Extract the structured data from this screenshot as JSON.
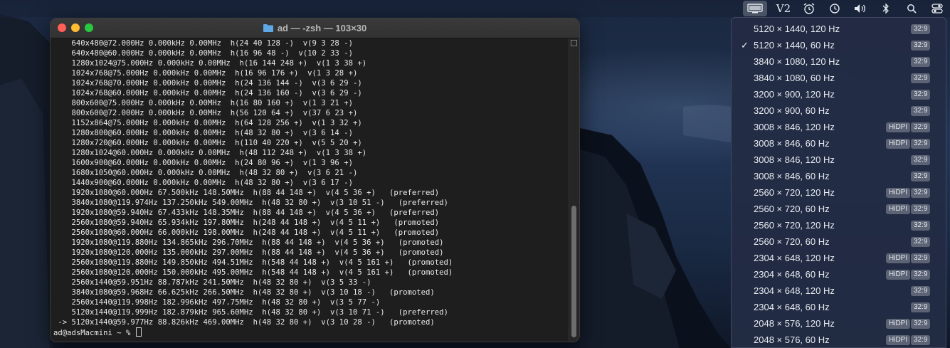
{
  "menubar": {
    "icons": [
      "display-icon",
      "v2-icon",
      "alarm-icon",
      "time-machine-icon",
      "volume-icon",
      "bluetooth-icon",
      "search-icon",
      "control-center-icon"
    ],
    "v2_label": "V2"
  },
  "terminal": {
    "title": "ad — -zsh — 103×30",
    "lines": [
      "    640x480@72.000Hz 0.000kHz 0.00MHz  h(24 40 128 -)  v(9 3 28 -)",
      "    640x480@60.000Hz 0.000kHz 0.00MHz  h(16 96 48 -)  v(10 2 33 -)",
      "    1280x1024@75.000Hz 0.000kHz 0.00MHz  h(16 144 248 +)  v(1 3 38 +)",
      "    1024x768@75.000Hz 0.000kHz 0.00MHz  h(16 96 176 +)  v(1 3 28 +)",
      "    1024x768@70.000Hz 0.000kHz 0.00MHz  h(24 136 144 -)  v(3 6 29 -)",
      "    1024x768@60.000Hz 0.000kHz 0.00MHz  h(24 136 160 -)  v(3 6 29 -)",
      "    800x600@75.000Hz 0.000kHz 0.00MHz  h(16 80 160 +)  v(1 3 21 +)",
      "    800x600@72.000Hz 0.000kHz 0.00MHz  h(56 120 64 +)  v(37 6 23 +)",
      "    1152x864@75.000Hz 0.000kHz 0.00MHz  h(64 128 256 +)  v(1 3 32 +)",
      "    1280x800@60.000Hz 0.000kHz 0.00MHz  h(48 32 80 +)  v(3 6 14 -)",
      "    1280x720@60.000Hz 0.000kHz 0.00MHz  h(110 40 220 +)  v(5 5 20 +)",
      "    1280x1024@60.000Hz 0.000kHz 0.00MHz  h(48 112 248 +)  v(1 3 38 +)",
      "    1600x900@60.000Hz 0.000kHz 0.00MHz  h(24 80 96 +)  v(1 3 96 +)",
      "    1680x1050@60.000Hz 0.000kHz 0.00MHz  h(48 32 80 +)  v(3 6 21 -)",
      "    1440x900@60.000Hz 0.000kHz 0.00MHz  h(48 32 80 +)  v(3 6 17 -)",
      "    1920x1080@60.000Hz 67.500kHz 148.50MHz  h(88 44 148 +)  v(4 5 36 +)   (preferred)",
      "    3840x1080@119.974Hz 137.250kHz 549.00MHz  h(48 32 80 +)  v(3 10 51 -)   (preferred)",
      "    1920x1080@59.940Hz 67.433kHz 148.35MHz  h(88 44 148 +)  v(4 5 36 +)   (preferred)",
      "    2560x1080@59.940Hz 65.934kHz 197.80MHz  h(248 44 148 +)  v(4 5 11 +)   (promoted)",
      "    2560x1080@60.000Hz 66.000kHz 198.00MHz  h(248 44 148 +)  v(4 5 11 +)   (promoted)",
      "    1920x1080@119.880Hz 134.865kHz 296.70MHz  h(88 44 148 +)  v(4 5 36 +)   (promoted)",
      "    1920x1080@120.000Hz 135.000kHz 297.00MHz  h(88 44 148 +)  v(4 5 36 +)   (promoted)",
      "    2560x1080@119.880Hz 149.850kHz 494.51MHz  h(548 44 148 +)  v(4 5 161 +)   (promoted)",
      "    2560x1080@120.000Hz 150.000kHz 495.00MHz  h(548 44 148 +)  v(4 5 161 +)   (promoted)",
      "    2560x1440@59.951Hz 88.787kHz 241.50MHz  h(48 32 80 +)  v(3 5 33 -)",
      "    3840x1080@59.968Hz 66.625kHz 266.50MHz  h(48 32 80 +)  v(3 10 18 -)   (promoted)",
      "    2560x1440@119.998Hz 182.996kHz 497.75MHz  h(48 32 80 +)  v(3 5 77 -)",
      "    5120x1440@119.999Hz 182.879kHz 965.60MHz  h(48 32 80 +)  v(3 10 71 -)   (preferred)",
      " -> 5120x1440@59.977Hz 88.826kHz 469.00MHz  h(48 32 80 +)  v(3 10 28 -)   (promoted)"
    ],
    "prompt": "ad@adsMacmini ~ % "
  },
  "resolutions": [
    {
      "label": "5120 × 1440, 120 Hz",
      "hidpi": false,
      "ratio": "32:9",
      "checked": false
    },
    {
      "label": "5120 × 1440, 60 Hz",
      "hidpi": false,
      "ratio": "32:9",
      "checked": true
    },
    {
      "label": "3840 × 1080, 120 Hz",
      "hidpi": false,
      "ratio": "32:9",
      "checked": false
    },
    {
      "label": "3840 × 1080, 60 Hz",
      "hidpi": false,
      "ratio": "32:9",
      "checked": false
    },
    {
      "label": "3200 × 900, 120 Hz",
      "hidpi": false,
      "ratio": "32:9",
      "checked": false
    },
    {
      "label": "3200 × 900, 60 Hz",
      "hidpi": false,
      "ratio": "32:9",
      "checked": false
    },
    {
      "label": "3008 × 846, 120 Hz",
      "hidpi": true,
      "ratio": "32:9",
      "checked": false
    },
    {
      "label": "3008 × 846, 60 Hz",
      "hidpi": true,
      "ratio": "32:9",
      "checked": false
    },
    {
      "label": "3008 × 846, 120 Hz",
      "hidpi": false,
      "ratio": "32:9",
      "checked": false
    },
    {
      "label": "3008 × 846, 60 Hz",
      "hidpi": false,
      "ratio": "32:9",
      "checked": false
    },
    {
      "label": "2560 × 720, 120 Hz",
      "hidpi": true,
      "ratio": "32:9",
      "checked": false
    },
    {
      "label": "2560 × 720, 60 Hz",
      "hidpi": true,
      "ratio": "32:9",
      "checked": false
    },
    {
      "label": "2560 × 720, 120 Hz",
      "hidpi": false,
      "ratio": "32:9",
      "checked": false
    },
    {
      "label": "2560 × 720, 60 Hz",
      "hidpi": false,
      "ratio": "32:9",
      "checked": false
    },
    {
      "label": "2304 × 648, 120 Hz",
      "hidpi": true,
      "ratio": "32:9",
      "checked": false
    },
    {
      "label": "2304 × 648, 60 Hz",
      "hidpi": true,
      "ratio": "32:9",
      "checked": false
    },
    {
      "label": "2304 × 648, 120 Hz",
      "hidpi": false,
      "ratio": "32:9",
      "checked": false
    },
    {
      "label": "2304 × 648, 60 Hz",
      "hidpi": false,
      "ratio": "32:9",
      "checked": false
    },
    {
      "label": "2048 × 576, 120 Hz",
      "hidpi": true,
      "ratio": "32:9",
      "checked": false
    },
    {
      "label": "2048 × 576, 60 Hz",
      "hidpi": true,
      "ratio": "32:9",
      "checked": false
    }
  ],
  "badges": {
    "hidpi_label": "HiDPI",
    "check_mark": "✓"
  },
  "colors": {
    "terminal_bg": "#1e1e1e",
    "menu_bg": "#222c44",
    "badge_bg": "#5b6374"
  }
}
